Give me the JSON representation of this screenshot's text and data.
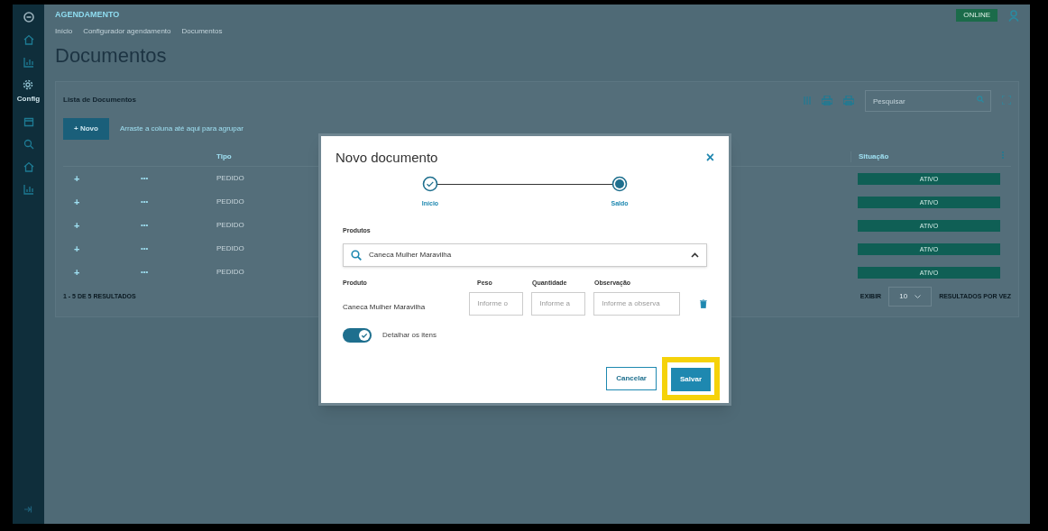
{
  "header": {
    "app_title": "AGENDAMENTO",
    "status_badge": "ONLINE"
  },
  "sidebar": {
    "config_label": "Config"
  },
  "breadcrumbs": [
    "Início",
    "Configurador agendamento",
    "Documentos"
  ],
  "page_title": "Documentos",
  "list": {
    "title": "Lista de Documentos",
    "new_button": "+ Novo",
    "group_hint": "Arraste a coluna até aqui para agrupar",
    "search_placeholder": "Pesquisar",
    "columns": [
      "Tipo",
      "Situação"
    ],
    "rows": [
      {
        "expand": "+",
        "menu": "•••",
        "tipo": "PEDIDO",
        "situacao": "ATIVO"
      },
      {
        "expand": "+",
        "menu": "•••",
        "tipo": "PEDIDO",
        "situacao": "ATIVO"
      },
      {
        "expand": "+",
        "menu": "•••",
        "tipo": "PEDIDO",
        "situacao": "ATIVO"
      },
      {
        "expand": "+",
        "menu": "•••",
        "tipo": "PEDIDO",
        "situacao": "ATIVO"
      },
      {
        "expand": "+",
        "menu": "•••",
        "tipo": "PEDIDO",
        "situacao": "ATIVO"
      }
    ],
    "results": "1 - 5 DE 5 RESULTADOS",
    "show_label": "EXIBIR",
    "page_size": "10",
    "per_page_label": "RESULTADOS POR VEZ"
  },
  "modal": {
    "title": "Novo documento",
    "close": "×",
    "steps": [
      {
        "label": "Início",
        "completed": true
      },
      {
        "label": "Saldo",
        "completed": false
      }
    ],
    "products_label": "Produtos",
    "products_value": "Caneca Mulher Maravilha",
    "item_columns": [
      "Produto",
      "Peso",
      "Quantidade",
      "Observação"
    ],
    "item": {
      "product": "Caneca Mulher Maravilha",
      "fields": [
        {
          "placeholder": "Informe o"
        },
        {
          "placeholder": "Informe a"
        },
        {
          "placeholder": "Informe a observa"
        }
      ]
    },
    "detail_toggle": {
      "label": "Detalhar os itens",
      "on": true
    },
    "buttons": [
      {
        "label": "Cancelar",
        "kind": "secondary",
        "highlighted": false
      },
      {
        "label": "Salvar",
        "kind": "primary",
        "highlighted": true
      }
    ]
  }
}
